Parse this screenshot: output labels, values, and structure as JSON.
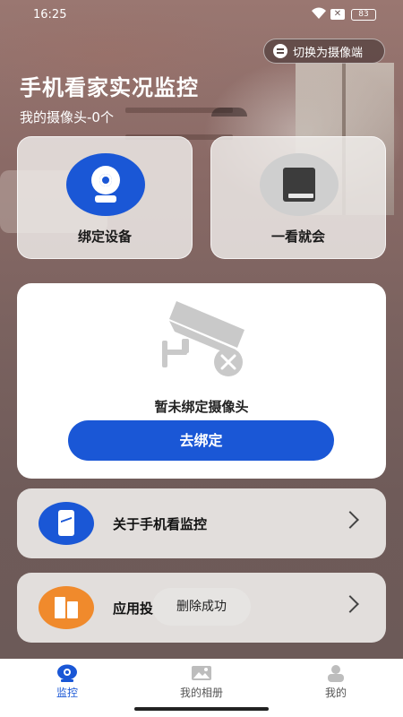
{
  "status_bar": {
    "time": "16:25",
    "battery": "83"
  },
  "header": {
    "switch_label": "切换为摄像端",
    "title": "手机看家实况监控",
    "subtitle": "我的摄像头-0个"
  },
  "quick_cards": [
    {
      "label": "绑定设备",
      "icon": "camera-icon",
      "color": "#1a57d6"
    },
    {
      "label": "一看就会",
      "icon": "book-icon",
      "color": "#cfcfcf"
    }
  ],
  "empty_state": {
    "message": "暂未绑定摄像头",
    "button_label": "去绑定"
  },
  "menu": [
    {
      "label": "关于手机看监控",
      "icon": "phone-chart-icon",
      "color": "#1a57d6"
    },
    {
      "label": "应用投",
      "icon": "building-icon",
      "color": "#f08a2c"
    }
  ],
  "toast": "删除成功",
  "tabs": [
    {
      "label": "监控",
      "active": true
    },
    {
      "label": "我的相册",
      "active": false
    },
    {
      "label": "我的",
      "active": false
    }
  ],
  "accent_color": "#1a57d6"
}
